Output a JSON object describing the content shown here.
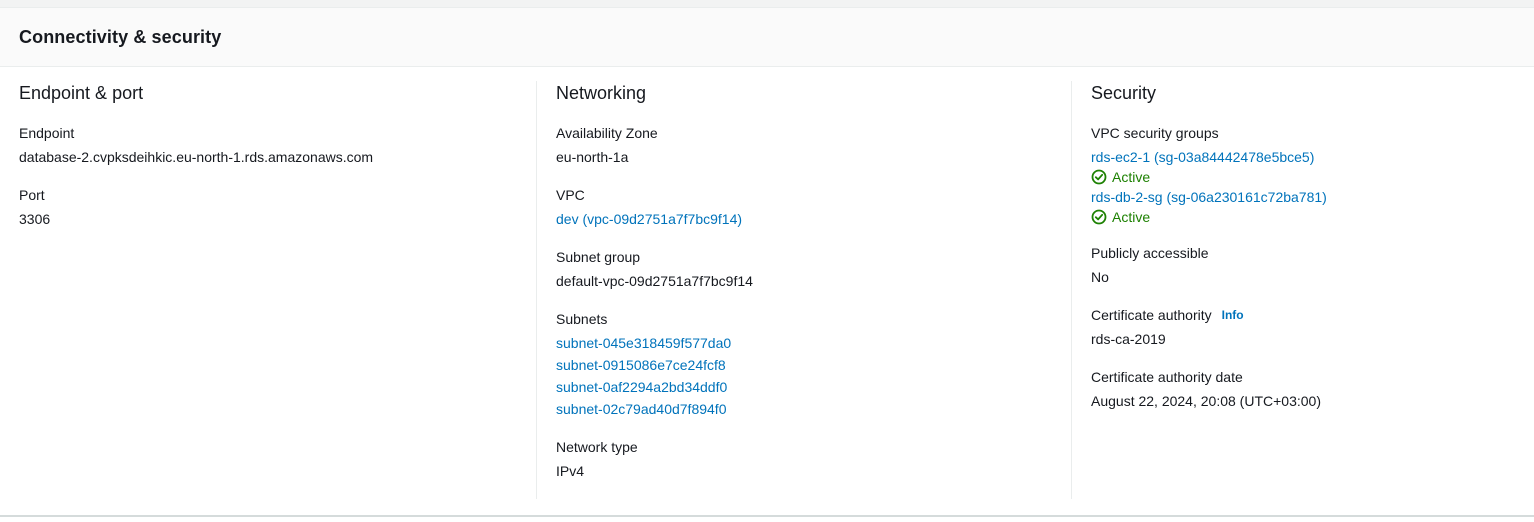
{
  "panel": {
    "title": "Connectivity & security"
  },
  "endpoint_port": {
    "heading": "Endpoint & port",
    "endpoint_label": "Endpoint",
    "endpoint_value": "database-2.cvpksdeihkic.eu-north-1.rds.amazonaws.com",
    "port_label": "Port",
    "port_value": "3306"
  },
  "networking": {
    "heading": "Networking",
    "az_label": "Availability Zone",
    "az_value": "eu-north-1a",
    "vpc_label": "VPC",
    "vpc_link": "dev (vpc-09d2751a7f7bc9f14)",
    "subnet_group_label": "Subnet group",
    "subnet_group_value": "default-vpc-09d2751a7f7bc9f14",
    "subnets_label": "Subnets",
    "subnets": [
      "subnet-045e318459f577da0",
      "subnet-0915086e7ce24fcf8",
      "subnet-0af2294a2bd34ddf0",
      "subnet-02c79ad40d7f894f0"
    ],
    "network_type_label": "Network type",
    "network_type_value": "IPv4"
  },
  "security": {
    "heading": "Security",
    "sg_label": "VPC security groups",
    "security_groups": [
      {
        "link": "rds-ec2-1 (sg-03a84442478e5bce5)",
        "status": "Active"
      },
      {
        "link": "rds-db-2-sg (sg-06a230161c72ba781)",
        "status": "Active"
      }
    ],
    "public_label": "Publicly accessible",
    "public_value": "No",
    "ca_label": "Certificate authority",
    "ca_info": "Info",
    "ca_value": "rds-ca-2019",
    "ca_date_label": "Certificate authority date",
    "ca_date_value": "August 22, 2024, 20:08 (UTC+03:00)"
  },
  "colors": {
    "link": "#0073bb",
    "success": "#1d8102",
    "text": "#16191f",
    "divider": "#eaeded"
  },
  "icons": {
    "status_active": "check-circle-icon"
  }
}
